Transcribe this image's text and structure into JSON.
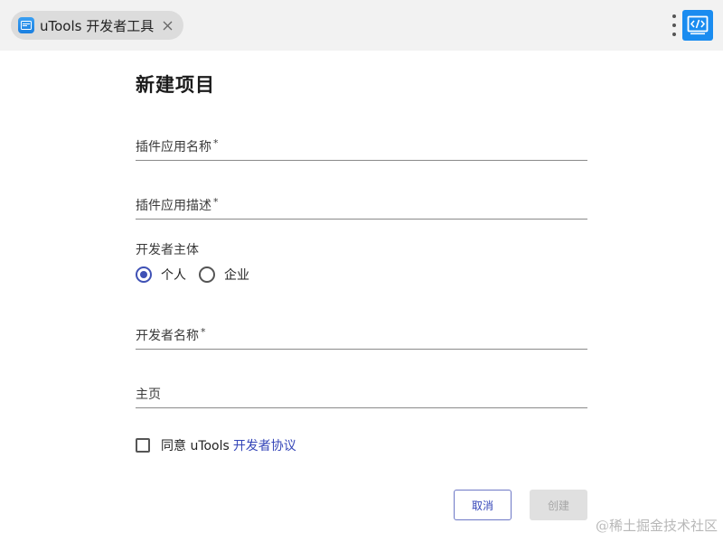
{
  "tab": {
    "title": "uTools 开发者工具",
    "icon": "terminal-app-icon",
    "close_icon": "close-icon"
  },
  "toolbar": {
    "menu_icon": "more-vertical-icon",
    "app_icon": "code-window-icon"
  },
  "form": {
    "title": "新建项目",
    "fields": {
      "name": {
        "label": "插件应用名称",
        "required_mark": "*",
        "value": ""
      },
      "description": {
        "label": "插件应用描述",
        "required_mark": "*",
        "value": ""
      },
      "developer_name": {
        "label": "开发者名称",
        "required_mark": "*",
        "value": ""
      },
      "homepage": {
        "label": "主页",
        "value": ""
      }
    },
    "developer_type": {
      "label": "开发者主体",
      "options": [
        {
          "label": "个人",
          "checked": true
        },
        {
          "label": "企业",
          "checked": false
        }
      ]
    },
    "agreement": {
      "prefix": "同意 uTools",
      "link": "开发者协议",
      "checked": false
    },
    "buttons": {
      "cancel": "取消",
      "create": "创建"
    }
  },
  "watermark": "@稀土掘金技术社区",
  "colors": {
    "accent": "#3f51b5",
    "link": "#3546b8",
    "app_icon_bg": "#1a8cf0",
    "disabled_bg": "#e0e0e0"
  }
}
